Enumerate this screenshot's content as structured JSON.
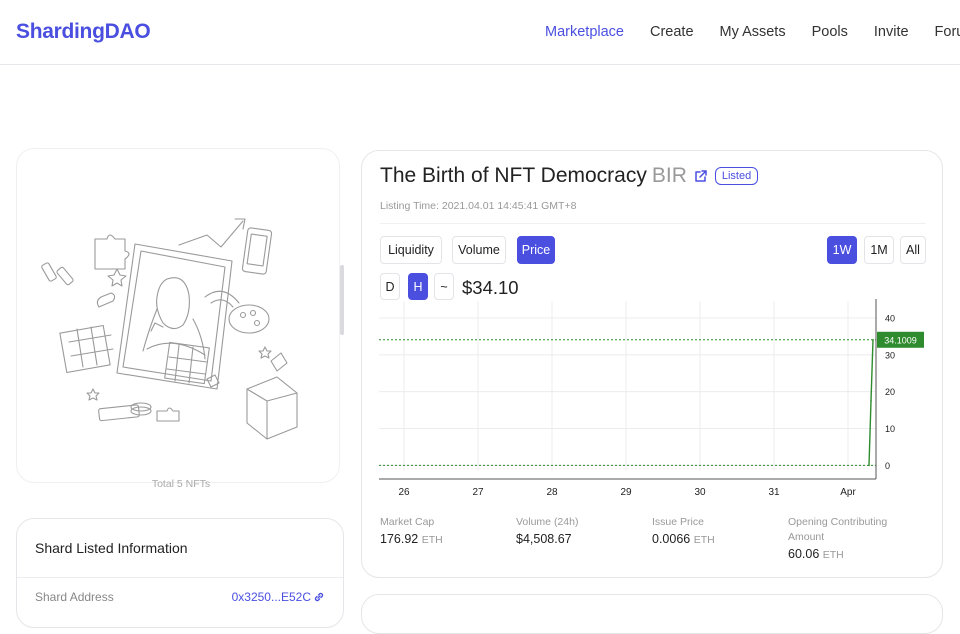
{
  "header": {
    "logo": "ShardingDAO",
    "nav": [
      {
        "label": "Marketplace",
        "active": true
      },
      {
        "label": "Create",
        "active": false
      },
      {
        "label": "My Assets",
        "active": false
      },
      {
        "label": "Pools",
        "active": false
      },
      {
        "label": "Invite",
        "active": false
      },
      {
        "label": "Foru",
        "active": false
      }
    ]
  },
  "artwork": {
    "total_label": "Total 5 NFTs"
  },
  "shard_info": {
    "title": "Shard Listed Information",
    "address_label": "Shard Address",
    "address_value": "0x3250...E52C"
  },
  "token": {
    "name": "The Birth of NFT Democracy",
    "symbol": "BIR",
    "status": "Listed",
    "listing_time": "Listing Time: 2021.04.01 14:45:41 GMT+8"
  },
  "chart_controls": {
    "metrics": [
      "Liquidity",
      "Volume",
      "Price"
    ],
    "active_metric": "Price",
    "ranges": [
      "1W",
      "1M",
      "All"
    ],
    "active_range": "1W",
    "intervals": [
      "D",
      "H",
      "~"
    ],
    "active_interval": "H",
    "current_price": "$34.10"
  },
  "chart_data": {
    "type": "line",
    "x_tick_labels": [
      "26",
      "27",
      "28",
      "29",
      "30",
      "31",
      "Apr"
    ],
    "y_tick_labels": [
      "0",
      "10",
      "20",
      "30",
      "40"
    ],
    "ylim": [
      -1,
      43
    ],
    "current_value_label": "34.1009",
    "current_value": 34.1009,
    "baseline_value": 0,
    "series": [
      {
        "points": [
          {
            "x": "Apr 01 13:00",
            "y": 0
          },
          {
            "x": "Apr 01 14:00",
            "y": 17.5
          },
          {
            "x": "Apr 01 15:00",
            "y": 34.1009
          }
        ]
      }
    ],
    "line_color": "#2e8b2e",
    "grid": true
  },
  "stats": [
    {
      "label": "Market Cap",
      "value": "176.92",
      "unit": "ETH"
    },
    {
      "label": "Volume (24h)",
      "value": "$4,508.67",
      "unit": ""
    },
    {
      "label": "Issue Price",
      "value": "0.0066",
      "unit": "ETH"
    },
    {
      "label": "Opening Contributing Amount",
      "value": "60.06",
      "unit": "ETH"
    }
  ],
  "colors": {
    "accent": "#4a4fe0",
    "chart_line": "#2e8b2e"
  }
}
